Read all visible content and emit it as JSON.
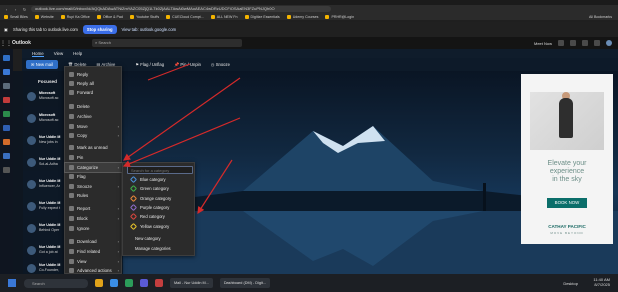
{
  "browser": {
    "url": "outlook.live.com/mail/0/inbox/id/AQQkADAwATNiZmYAZC05ZjQ1LTk0ZjAALTAwAi0wMAoAEAC4wDRzUDCFiOSAaEN3FZuPNJQh0O",
    "bookmarks": [
      "Small Biles",
      "Website",
      "Rupi Ka Office",
      "Office & Pad",
      "Youtube Stuffs",
      "CUECloud Compt...",
      "ALL NEW Fn",
      "Digitize Essentials",
      "Udemy Courses",
      "PRHR@Login"
    ],
    "all_bookmarks": "All Bookmarks"
  },
  "sharebar": {
    "message": "Sharing this tab to outlook.live.com",
    "stop": "Stop sharing",
    "view_tab": "View tab: outlook.google.com"
  },
  "outlook": {
    "brand": "Outlook",
    "search_placeholder": "Search",
    "meet_now": "Meet Now",
    "tabs": [
      "Home",
      "View",
      "Help"
    ],
    "toolbar": {
      "new_mail": "New mail",
      "delete": "Delete",
      "archive": "Archive",
      "flag": "Flag / Unflag",
      "pin": "Pin / Unpin",
      "snooze": "Snooze"
    },
    "list_header": "Focused",
    "mails": [
      {
        "sender": "Microsoft",
        "subject": "Microsoft ac",
        "preview": ""
      },
      {
        "sender": "Microsoft",
        "subject": "Microsoft ac",
        "preview": ""
      },
      {
        "sender": "Nur Uddin M",
        "subject": "New jobs in",
        "preview": ""
      },
      {
        "sender": "Nur Uddin M",
        "subject": "Sol-al-Adha",
        "preview": ""
      },
      {
        "sender": "Nur Uddin M",
        "subject": "Influencer, Ar",
        "preview": ""
      },
      {
        "sender": "Nur Uddin M",
        "subject": "Fully expect t",
        "preview": ""
      },
      {
        "sender": "Nur Uddin M",
        "subject": "Behind Oper",
        "preview": ""
      },
      {
        "sender": "Nur Uddin M",
        "subject": "Got a job at",
        "preview": ""
      },
      {
        "sender": "Nur Uddin M",
        "subject": "Co-Founder,",
        "preview": ""
      }
    ]
  },
  "context_menu": {
    "items": [
      {
        "label": "Reply",
        "arrow": ""
      },
      {
        "label": "Reply all",
        "arrow": ""
      },
      {
        "label": "Forward",
        "arrow": ""
      },
      {
        "label": "Delete",
        "arrow": ""
      },
      {
        "label": "Archive",
        "arrow": ""
      },
      {
        "label": "Move",
        "arrow": "›"
      },
      {
        "label": "Copy",
        "arrow": "›"
      },
      {
        "label": "Mark as unread",
        "arrow": ""
      },
      {
        "label": "Pin",
        "arrow": ""
      },
      {
        "label": "Categorize",
        "arrow": "›"
      },
      {
        "label": "Flag",
        "arrow": ""
      },
      {
        "label": "Snooze",
        "arrow": "›"
      },
      {
        "label": "Rules",
        "arrow": ""
      },
      {
        "label": "Report",
        "arrow": "›"
      },
      {
        "label": "Block",
        "arrow": "›"
      },
      {
        "label": "Ignore",
        "arrow": ""
      },
      {
        "label": "Download",
        "arrow": "›"
      },
      {
        "label": "Find related",
        "arrow": "›"
      },
      {
        "label": "View",
        "arrow": "›"
      },
      {
        "label": "Advanced actions",
        "arrow": "›"
      }
    ]
  },
  "categories_menu": {
    "search_placeholder": "Search for a category",
    "categories": [
      {
        "label": "Blue category",
        "color": "#4a90d9"
      },
      {
        "label": "Green category",
        "color": "#3fae49"
      },
      {
        "label": "Orange category",
        "color": "#e8873a"
      },
      {
        "label": "Purple category",
        "color": "#8e6cc8"
      },
      {
        "label": "Red category",
        "color": "#d9463e"
      },
      {
        "label": "Yellow category",
        "color": "#e6c229"
      }
    ],
    "new_category": "New category",
    "manage_categories": "Manage categories"
  },
  "ad": {
    "headline_1": "Elevate your",
    "headline_2": "experience",
    "headline_3": "in the sky",
    "cta": "BOOK NOW",
    "brand": "CATHAY PACIFIC",
    "tagline": "MOVE BEYOND"
  },
  "taskbar": {
    "search": "Search",
    "windows": [
      "Mail - Nur Uddin M...",
      "Dashboard (DM) - Digit..."
    ],
    "desktop": "Desktop",
    "time": "11:40 AM",
    "date": "8/7/2025"
  },
  "accent": "#2f6fc7",
  "annotation_color": "#d42a2a"
}
